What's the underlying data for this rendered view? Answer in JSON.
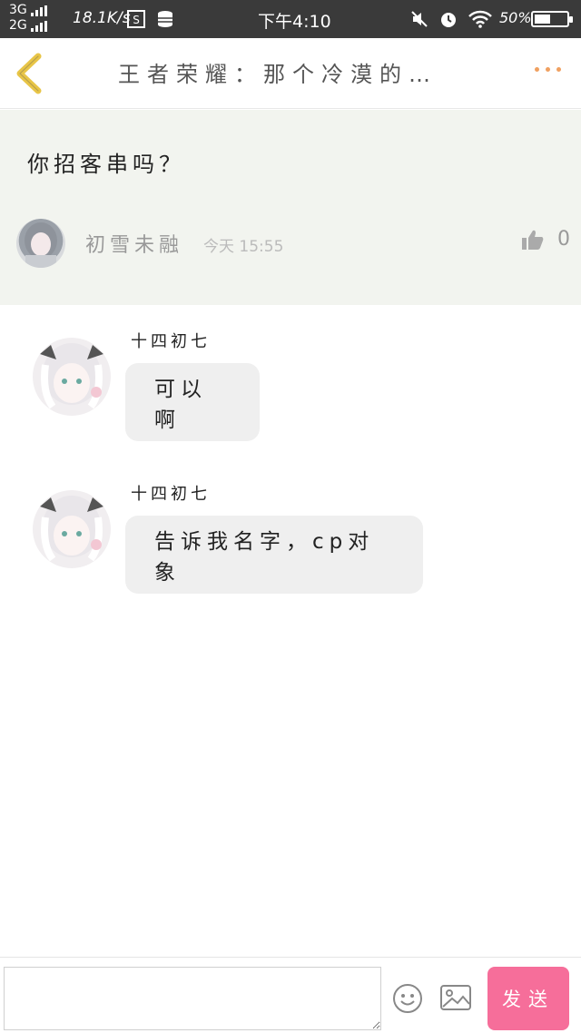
{
  "status_bar": {
    "network_top": "3G",
    "network_bottom": "2G",
    "speed": "18.1K/s",
    "time": "下午4:10",
    "battery_percent": "50%",
    "battery_level": 0.5
  },
  "nav": {
    "title": "王者荣耀：那个冷漠的…"
  },
  "question": {
    "text": "你招客串吗？",
    "author": "初雪未融",
    "time": "今天 15:55",
    "likes": "0"
  },
  "replies": [
    {
      "name": "十四初七",
      "text": "可以啊"
    },
    {
      "name": "十四初七",
      "text": "告诉我名字，cp对象"
    }
  ],
  "input": {
    "value": "",
    "placeholder": "",
    "send_label": "发送"
  },
  "colors": {
    "status_bar_bg": "#3a3a3a",
    "accent_back": "#e8c547",
    "more_dots": "#f0a060",
    "question_bg": "#f2f4ef",
    "bubble_bg": "#efefef",
    "send_button": "#f66e9a"
  }
}
